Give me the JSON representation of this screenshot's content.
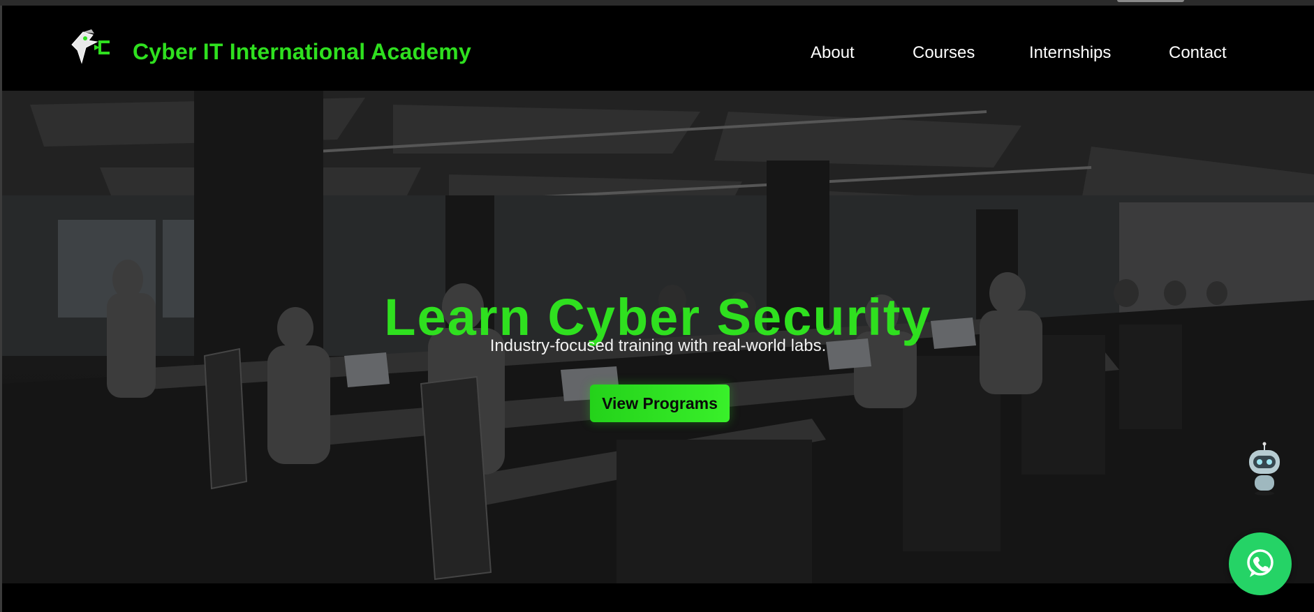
{
  "header": {
    "brand": "Cyber IT International Academy",
    "logo_icon": "cyber-hawk-logo-icon",
    "nav": [
      {
        "label": "About"
      },
      {
        "label": "Courses"
      },
      {
        "label": "Internships"
      },
      {
        "label": "Contact"
      }
    ]
  },
  "hero": {
    "title": "Learn Cyber Security",
    "subtitle": "Industry-focused training with real-world labs.",
    "cta_label": "View Programs",
    "background": "classroom-photo"
  },
  "widgets": {
    "chatbot_icon": "robot-chat-icon",
    "whatsapp_icon": "whatsapp-icon"
  },
  "colors": {
    "accent": "#2fe01f",
    "background": "#000000",
    "whatsapp": "#25d366"
  }
}
